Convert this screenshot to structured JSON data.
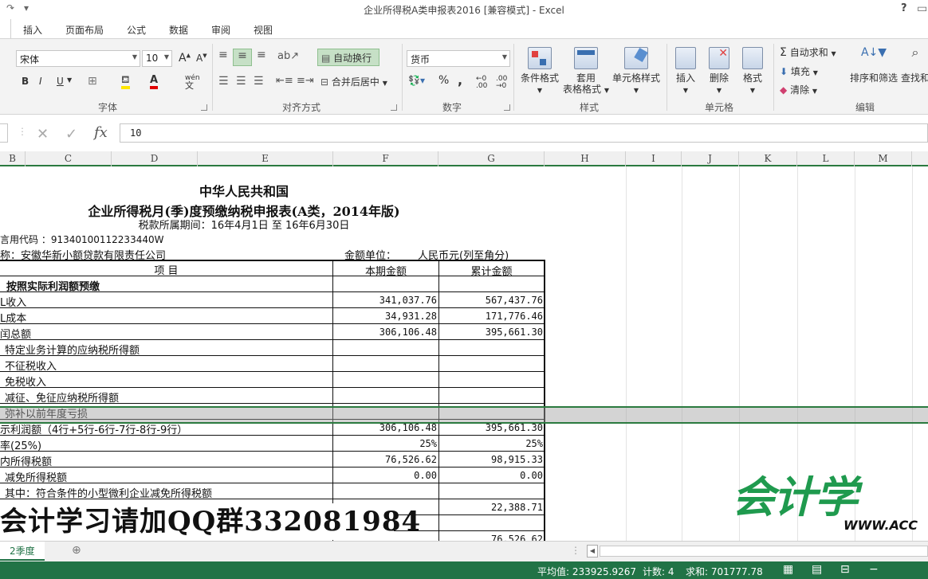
{
  "window": {
    "title": "企业所得税A类申报表2016  [兼容模式] - Excel",
    "help": "?"
  },
  "tabs": [
    "插入",
    "页面布局",
    "公式",
    "数据",
    "审阅",
    "视图"
  ],
  "ribbon": {
    "font": {
      "name": "宋体",
      "size": "10",
      "grow": "A",
      "shrink": "A",
      "bold": "B",
      "italic": "I",
      "underline": "U",
      "phonetic": "wén",
      "label": "字体"
    },
    "align": {
      "wrap_text": "自动换行",
      "merge_center": "合并后居中",
      "label": "对齐方式"
    },
    "number": {
      "format": "货币",
      "percent": "%",
      "comma": ",",
      "label": "数字"
    },
    "styles": {
      "conditional": "条件格式",
      "table_1": "套用",
      "table_2": "表格格式",
      "cell_styles": "单元格样式",
      "label": "样式"
    },
    "cells": {
      "insert": "插入",
      "delete": "删除",
      "format": "格式",
      "label": "单元格"
    },
    "editing": {
      "autosum": "自动求和",
      "fill": "填充",
      "clear": "清除",
      "sort_filter": "排序和筛选",
      "find_select": "查找和",
      "label": "编辑"
    }
  },
  "formula_bar": {
    "fx": "fx",
    "value": "10"
  },
  "columns": [
    {
      "label": "B"
    },
    {
      "label": "C"
    },
    {
      "label": "D"
    },
    {
      "label": "E"
    },
    {
      "label": "F"
    },
    {
      "label": "G"
    },
    {
      "label": "H"
    },
    {
      "label": "I"
    },
    {
      "label": "J"
    },
    {
      "label": "K"
    },
    {
      "label": "L"
    },
    {
      "label": "M"
    }
  ],
  "sheet": {
    "title1": "中华人民共和国",
    "title2": "企业所得税月(季)度预缴纳税申报表(A类，2014年版)",
    "period": "税款所属期间：16年4月1日 至 16年6月30日",
    "taxid": "言用代码 ：91340100112233440W",
    "company": "称：安徽华新小额贷款有限责任公司",
    "unit_label": "金额单位：",
    "unit_value": "人民币元(列至角分)",
    "hdr_item": "项        目",
    "hdr_current": "本期金额",
    "hdr_cumulative": "累计金额",
    "rows": [
      {
        "item": "按照实际利润额预缴",
        "cur": "",
        "cum": ""
      },
      {
        "item": "L收入",
        "cur": "341,037.76",
        "cum": "567,437.76"
      },
      {
        "item": "L成本",
        "cur": "34,931.28",
        "cum": "171,776.46"
      },
      {
        "item": "闰总额",
        "cur": "306,106.48",
        "cum": "395,661.30"
      },
      {
        "item": "特定业务计算的应纳税所得额",
        "cur": "",
        "cum": ""
      },
      {
        "item": "不征税收入",
        "cur": "",
        "cum": ""
      },
      {
        "item": "免税收入",
        "cur": "",
        "cum": ""
      },
      {
        "item": "减征、免征应纳税所得额",
        "cur": "",
        "cum": ""
      },
      {
        "item": "弥补以前年度亏损",
        "cur": "",
        "cum": ""
      },
      {
        "item": "示利润额（4行+5行-6行-7行-8行-9行）",
        "cur": "306,106.48",
        "cum": "395,661.30"
      },
      {
        "item": "率(25%)",
        "cur": "25%",
        "cum": "25%"
      },
      {
        "item": "内所得税额",
        "cur": "76,526.62",
        "cum": "98,915.33"
      },
      {
        "item": "减免所得税额",
        "cur": "0.00",
        "cum": "0.00"
      },
      {
        "item": "其中：符合条件的小型微利企业减免所得税额",
        "cur": "",
        "cum": ""
      },
      {
        "item": "",
        "cur": "",
        "cum": "22,388.71"
      },
      {
        "item": "",
        "cur": "",
        "cum": ""
      },
      {
        "item": "",
        "cur": "",
        "cum": "76,526.62"
      }
    ]
  },
  "watermark": "会计学习请加QQ群332081984",
  "logo": {
    "text": "会计学",
    "url": "WWW.ACC"
  },
  "sheet_tab": "2季度",
  "status": {
    "average": "平均值: 233925.9267",
    "count": "计数: 4",
    "sum": "求和: 701777.78"
  },
  "colors": {
    "excel_green": "#217346",
    "logo_green": "#1f9a4e"
  }
}
